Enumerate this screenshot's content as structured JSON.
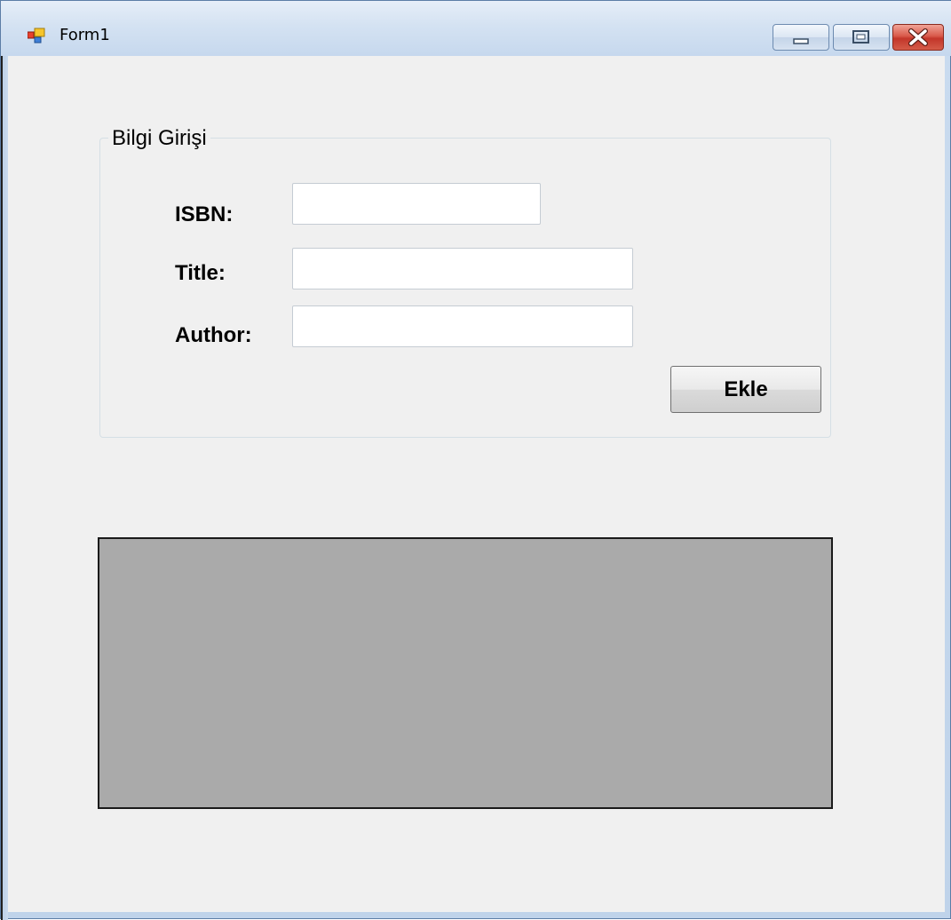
{
  "window": {
    "title": "Form1",
    "icon": "winforms-app-icon"
  },
  "caption_buttons": {
    "minimize_icon": "minimize-icon",
    "maximize_icon": "maximize-icon",
    "close_icon": "close-icon"
  },
  "groupbox": {
    "title": "Bilgi Girişi",
    "fields": {
      "isbn": {
        "label": "ISBN:",
        "value": ""
      },
      "title": {
        "label": "Title:",
        "value": ""
      },
      "author": {
        "label": "Author:",
        "value": ""
      }
    },
    "add_button_label": "Ekle"
  },
  "colors": {
    "form_background": "#f0f0f0",
    "panel_background": "#aaaaaa",
    "close_button": "#c3362a"
  }
}
